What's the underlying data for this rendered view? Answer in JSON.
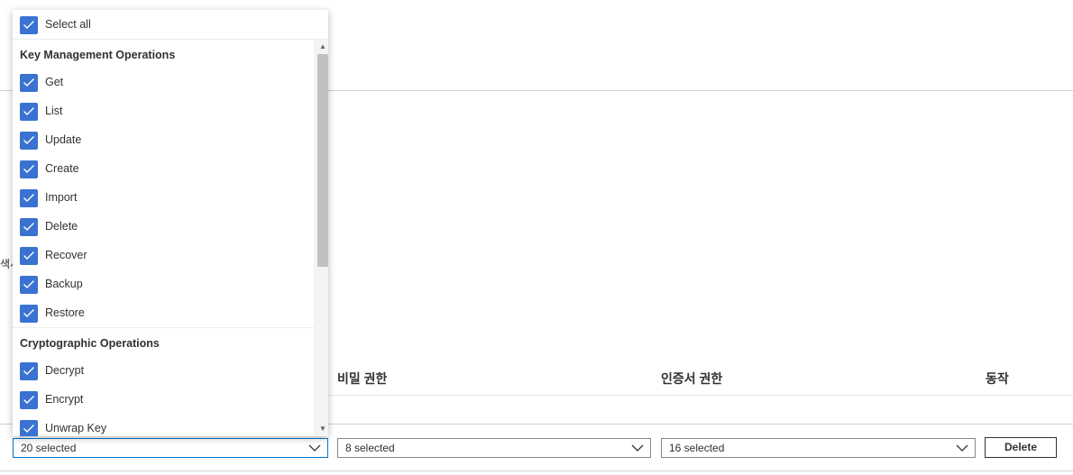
{
  "background": {
    "clipped_label": "색서",
    "columns": {
      "secret_perms": "비밀 권한",
      "cert_perms": "인증서 권한",
      "action": "동작"
    }
  },
  "dropdowns": {
    "key_perms": "20 selected",
    "secret_perms": "8 selected",
    "cert_perms": "16 selected"
  },
  "delete_label": "Delete",
  "panel": {
    "select_all": "Select all",
    "groups": [
      {
        "title": "Key Management Operations",
        "items": [
          "Get",
          "List",
          "Update",
          "Create",
          "Import",
          "Delete",
          "Recover",
          "Backup",
          "Restore"
        ]
      },
      {
        "title": "Cryptographic Operations",
        "items": [
          "Decrypt",
          "Encrypt",
          "Unwrap Key"
        ]
      }
    ]
  },
  "colors": {
    "checkbox": "#3a72d2",
    "focus_border": "#0078d4",
    "scroll_thumb": "#c1c1c1"
  }
}
